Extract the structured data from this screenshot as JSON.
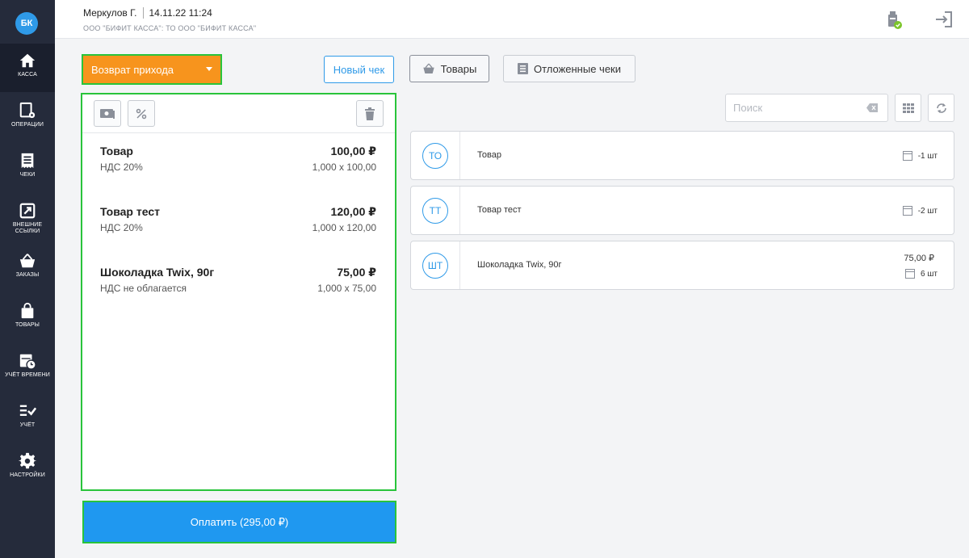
{
  "sidebar": {
    "logo": "БК",
    "items": [
      {
        "label": "КАССА",
        "icon": "home-icon"
      },
      {
        "label": "ОПЕРАЦИИ",
        "icon": "operations-icon"
      },
      {
        "label": "ЧЕКИ",
        "icon": "receipts-icon"
      },
      {
        "label": "ВНЕШНИЕ ССЫЛКИ",
        "icon": "external-links-icon"
      },
      {
        "label": "ЗАКАЗЫ",
        "icon": "basket-icon"
      },
      {
        "label": "ТОВАРЫ",
        "icon": "bag-icon"
      },
      {
        "label": "УЧЁТ ВРЕМЕНИ",
        "icon": "calendar-clock-icon"
      },
      {
        "label": "УЧЁТ",
        "icon": "checklist-icon"
      },
      {
        "label": "НАСТРОЙКИ",
        "icon": "gear-icon"
      }
    ]
  },
  "header": {
    "user": "Меркулов Г.",
    "datetime": "14.11.22 11:24",
    "organization": "ООО \"БИФИТ КАССА\": ТО ООО \"БИФИТ КАССА\""
  },
  "toolbar": {
    "mode": "Возврат прихода",
    "new_receipt": "Новый чек",
    "goods": "Товары",
    "deferred": "Отложенные чеки"
  },
  "receipt": {
    "items": [
      {
        "name": "Товар",
        "price": "100,00 ₽",
        "tax": "НДС 20%",
        "qty": "1,000 x 100,00"
      },
      {
        "name": "Товар тест",
        "price": "120,00 ₽",
        "tax": "НДС 20%",
        "qty": "1,000 x 120,00"
      },
      {
        "name": "Шоколадка Twix, 90г",
        "price": "75,00 ₽",
        "tax": "НДС не облагается",
        "qty": "1,000 x 75,00"
      }
    ],
    "pay_label": "Оплатить (295,00 ₽)"
  },
  "search": {
    "placeholder": "Поиск"
  },
  "products": [
    {
      "abbr": "ТО",
      "name": "Товар",
      "stock": "-1 шт"
    },
    {
      "abbr": "ТТ",
      "name": "Товар тест",
      "stock": "-2 шт"
    },
    {
      "abbr": "ШТ",
      "name": "Шоколадка Twix, 90г",
      "price": "75,00 ₽",
      "stock": "6 шт"
    }
  ],
  "colors": {
    "sidebar_bg": "#252b3b",
    "accent_blue": "#2f9ae8",
    "mode_orange": "#f7941d",
    "pay_blue": "#1f98f0",
    "highlight_green": "#29c43b"
  }
}
